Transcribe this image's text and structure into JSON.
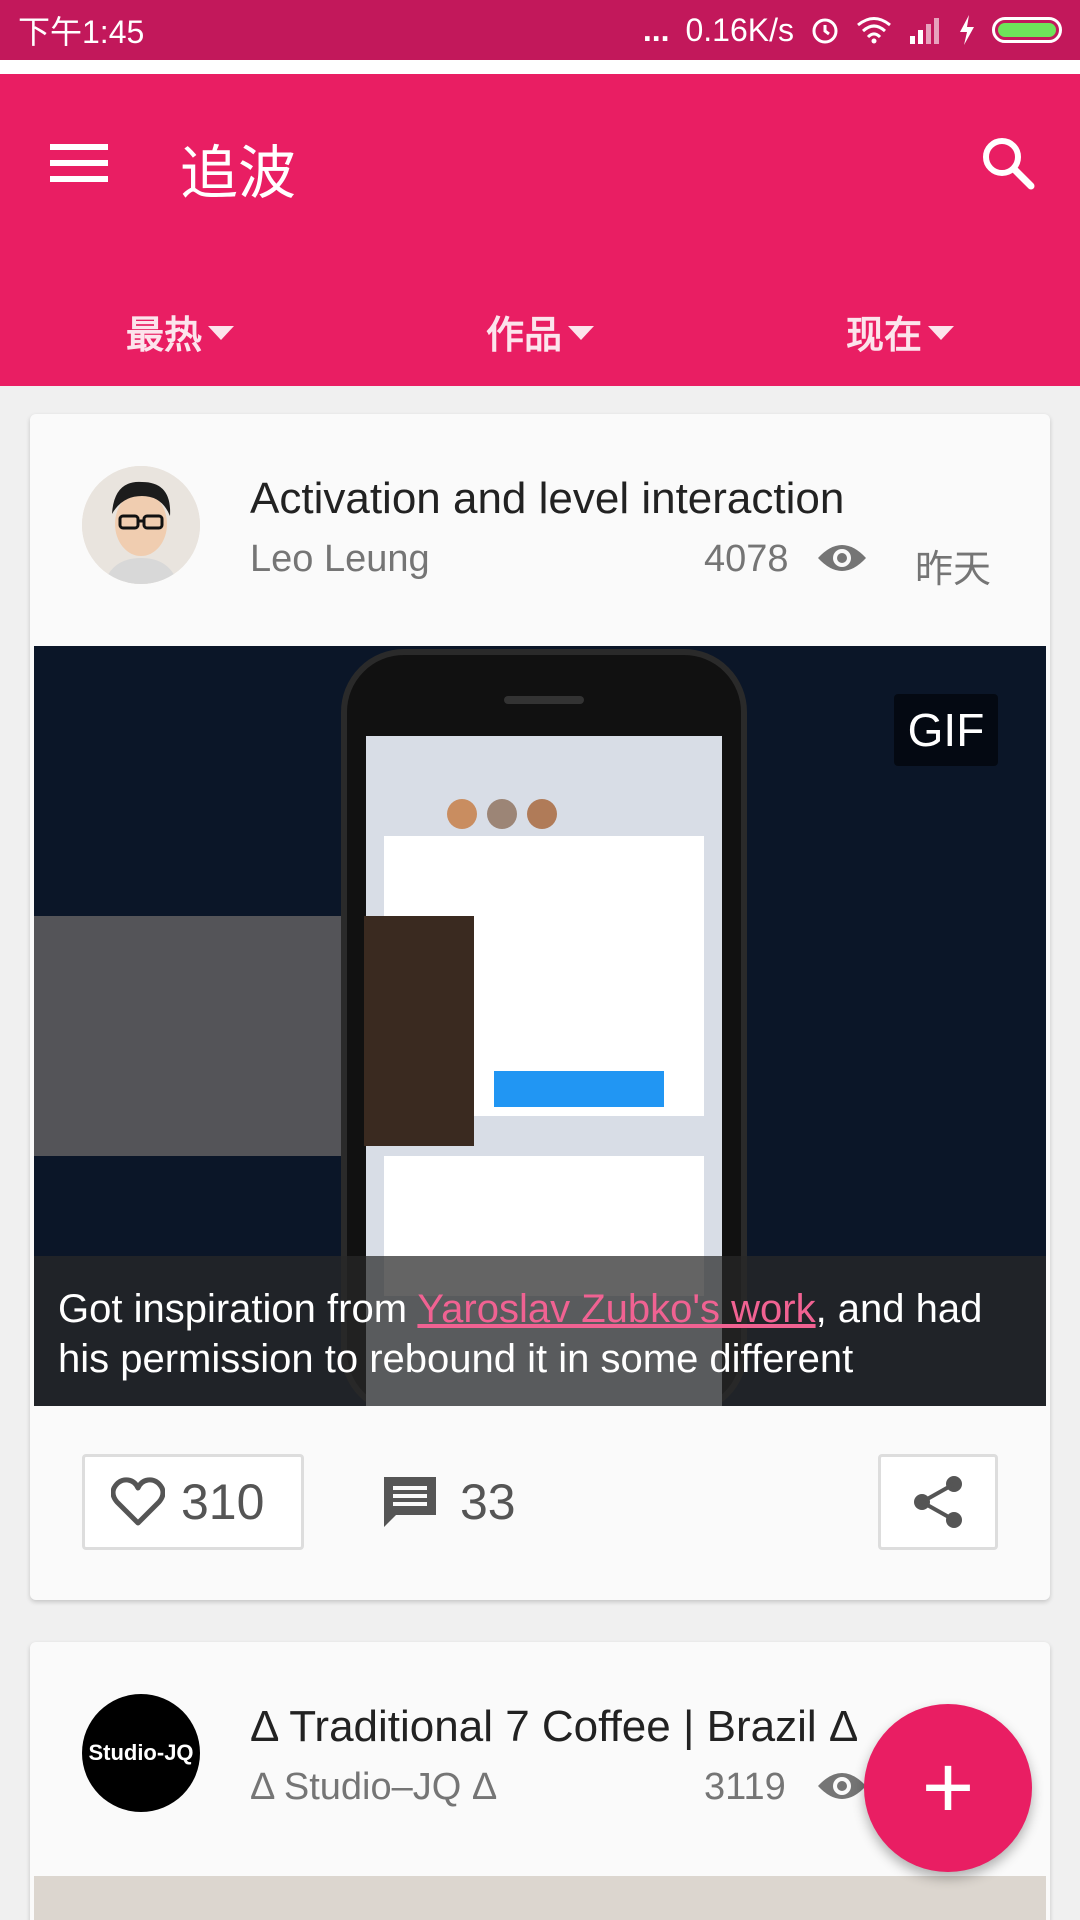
{
  "status_bar": {
    "time": "下午1:45",
    "network_speed": "0.16K/s",
    "dots": "..."
  },
  "app_bar": {
    "title": "追波",
    "menu_icon": "menu-icon",
    "search_icon": "search-icon",
    "color": "#e91e63"
  },
  "filters": [
    {
      "label": "最热"
    },
    {
      "label": "作品"
    },
    {
      "label": "现在"
    }
  ],
  "posts": [
    {
      "title": "Activation and level interaction",
      "author": "Leo Leung",
      "views": "4078",
      "date": "昨天",
      "badge": "GIF",
      "caption_before": "Got inspiration from ",
      "caption_link": "Yaroslav Zubko's work",
      "caption_after": ", and had his permission to rebound it in some different",
      "likes": "310",
      "comments": "33"
    },
    {
      "title": "Δ Traditional 7 Coffee | Brazil Δ",
      "author": "Δ Studio–JQ Δ",
      "avatar_text": "Studio-JQ",
      "views": "3119"
    }
  ],
  "fab": {
    "label": "+"
  },
  "accent_color": "#e91e63",
  "status_color": "#c2185b"
}
